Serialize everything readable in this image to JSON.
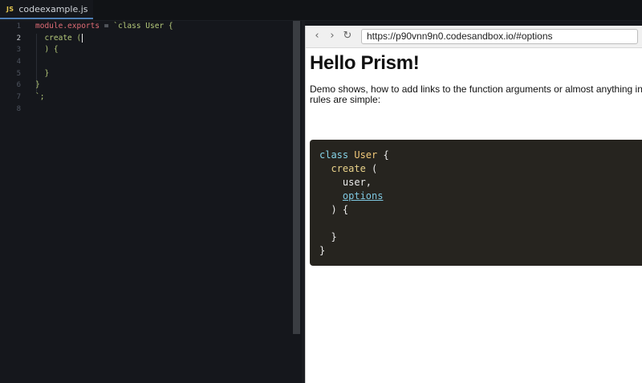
{
  "tab": {
    "icon_label": "JS",
    "filename": "codeexample.js"
  },
  "editor": {
    "line_numbers": [
      "1",
      "2",
      "3",
      "4",
      "5",
      "6",
      "7",
      "8"
    ],
    "lines": {
      "l1_a": "module.exports",
      "l1_b": " = ",
      "l1_c": "`class User {",
      "l2": "  create (",
      "l3": "  ) {",
      "l4": "",
      "l5": "  }",
      "l6": "}",
      "l7": "`;",
      "l8": ""
    }
  },
  "browser": {
    "url": "https://p90vnn9n0.codesandbox.io/#options",
    "back_icon": "‹",
    "forward_icon": "›",
    "reload_icon": "↻",
    "heading": "Hello Prism!",
    "description": "Demo shows, how to add links to the function arguments or almost anything inside rules are simple:",
    "code": {
      "kw_class": "class",
      "cls_user": "User",
      "brace_open": " {",
      "fn_create": "create",
      "paren_open": " (",
      "arg_user": "user,",
      "arg_options": "options",
      "paren_close": ") {",
      "inner_close": "}",
      "outer_close": "}"
    }
  }
}
